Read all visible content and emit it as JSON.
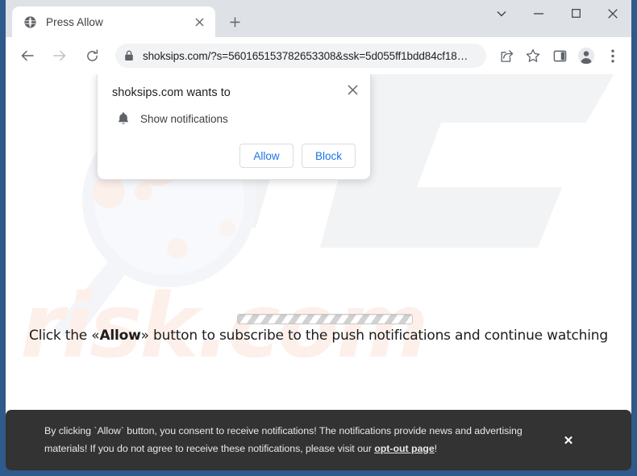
{
  "browser": {
    "window_controls": {
      "tab_search": "tab-search-chevron",
      "minimize": "minimize",
      "maximize": "maximize",
      "close": "close"
    },
    "tab": {
      "favicon": "globe-icon",
      "title": "Press Allow",
      "close_label": "×"
    },
    "new_tab_label": "+",
    "nav": {
      "back": "back-arrow-icon",
      "forward": "forward-arrow-icon",
      "reload": "reload-icon"
    },
    "omnibox": {
      "lock_icon": "lock-icon",
      "url": "shoksips.com/?s=560165153782653308&ssk=5d055ff1bdd84cf18…"
    },
    "toolbar_icons": {
      "share": "share-icon",
      "bookmark": "star-icon",
      "side_panel": "side-panel-icon",
      "profile": "profile-avatar-icon",
      "menu": "three-dot-menu-icon"
    }
  },
  "permission_dialog": {
    "title": "shoksips.com wants to",
    "permission_icon": "bell-icon",
    "permission_label": "Show notifications",
    "allow_label": "Allow",
    "block_label": "Block",
    "close_label": "×"
  },
  "page": {
    "cta_prefix": "Click the «",
    "cta_bold": "Allow",
    "cta_suffix": "» button to subscribe to the push notifications and continue watching",
    "watermark_text": "risk.com",
    "progress_label": "loading-progress-bar"
  },
  "consent_banner": {
    "text_before_link": "By clicking `Allow` button, you consent to receive notifications! The notifications provide news and advertising materials! If you do not agree to receive these notifications, please visit our ",
    "link_text": "opt-out page",
    "text_after_link": "!",
    "close_label": "✕"
  },
  "colors": {
    "window_border": "#2e5a8c",
    "tabstrip": "#dee1e6",
    "omnibox": "#f1f3f4",
    "link_blue": "#1a73e8",
    "banner_bg": "#333333",
    "watermark_peach": "#fdf0ea"
  }
}
